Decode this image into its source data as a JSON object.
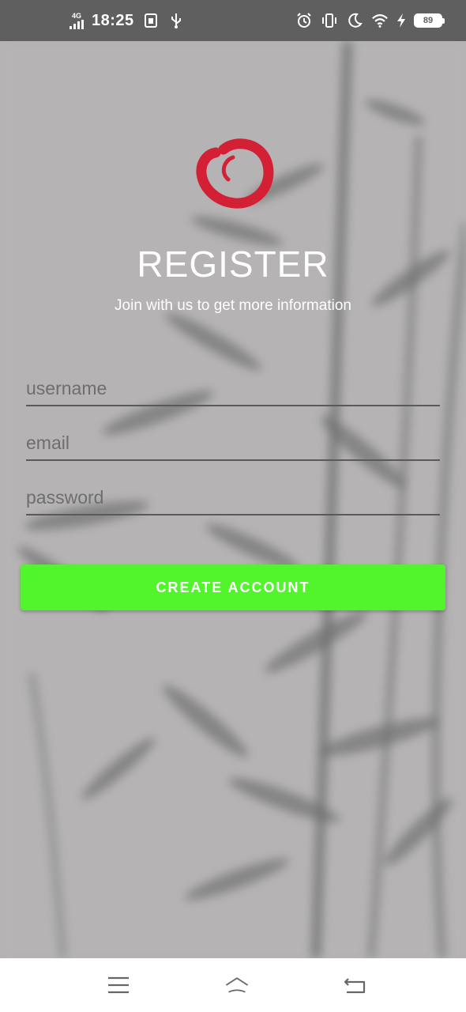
{
  "status_bar": {
    "network": "4G",
    "time": "18:25",
    "battery": "89",
    "icons": [
      "signal-icon",
      "sim-icon",
      "usb-icon",
      "alarm-icon",
      "vibrate-icon",
      "moon-icon",
      "wifi-icon",
      "charging-icon",
      "battery-icon"
    ]
  },
  "register": {
    "title": "REGISTER",
    "subtitle": "Join with us to get more information",
    "username_placeholder": "username",
    "email_placeholder": "email",
    "password_placeholder": "password",
    "create_account_label": "CREATE ACCOUNT"
  },
  "colors": {
    "status_bar": "#5f5f5f",
    "background": "#b5b3b3",
    "accent_button": "#52f52c",
    "logo": "#d42035"
  },
  "nav_bar": {
    "icons": [
      "menu-icon",
      "home-icon",
      "back-icon"
    ]
  }
}
